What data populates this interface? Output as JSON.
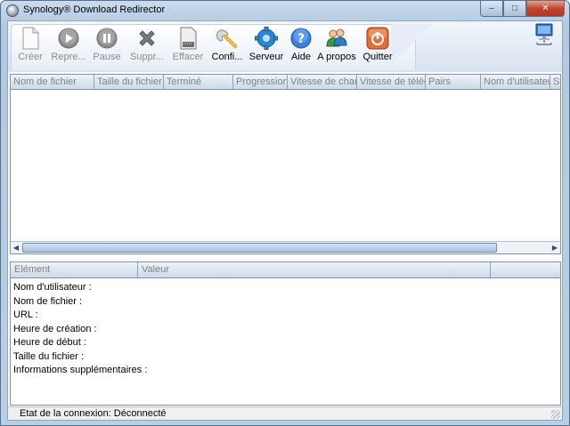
{
  "window": {
    "title": "Synology® Download Redirector",
    "minimize": "–",
    "maximize": "□",
    "close": "✕"
  },
  "toolbar": {
    "buttons": [
      {
        "label": "Créer",
        "icon": "page-icon",
        "enabled": false
      },
      {
        "label": "Repre...",
        "icon": "play-icon",
        "enabled": false
      },
      {
        "label": "Pause",
        "icon": "pause-icon",
        "enabled": false
      },
      {
        "label": "Suppr...",
        "icon": "delete-x-icon",
        "enabled": false
      },
      {
        "label": "Effacer",
        "icon": "clear-document-icon",
        "enabled": false
      },
      {
        "label": "Confi...",
        "icon": "wrench-icon",
        "enabled": true
      },
      {
        "label": "Serveur",
        "icon": "server-gear-icon",
        "enabled": true
      },
      {
        "label": "Aide",
        "icon": "help-icon",
        "enabled": true
      },
      {
        "label": "A propos",
        "icon": "users-icon",
        "enabled": true
      },
      {
        "label": "Quitter",
        "icon": "power-icon",
        "enabled": true
      }
    ],
    "network_icon": "network-computer-icon"
  },
  "download_table": {
    "columns": [
      "Nom de fichier",
      "Taille du fichier",
      "Terminé",
      "Progression",
      "Vitesse de char",
      "Vitesse de téléc",
      "Pairs",
      "Nom d'utilisateu",
      "St"
    ],
    "rows": []
  },
  "details": {
    "columns": [
      "Elément",
      "Valeur",
      ""
    ],
    "rows": [
      "Nom d'utilisateur :",
      "Nom de fichier :",
      "URL :",
      "Heure de création :",
      "Heure de début :",
      "Taille du fichier :",
      "Informations supplémentaires :"
    ]
  },
  "status": {
    "text": "Etat de la connexion: Déconnecté"
  },
  "colors": {
    "frame": "#b9cfe6",
    "header": "#cddaea",
    "scroll_thumb": "#a9c2df"
  }
}
